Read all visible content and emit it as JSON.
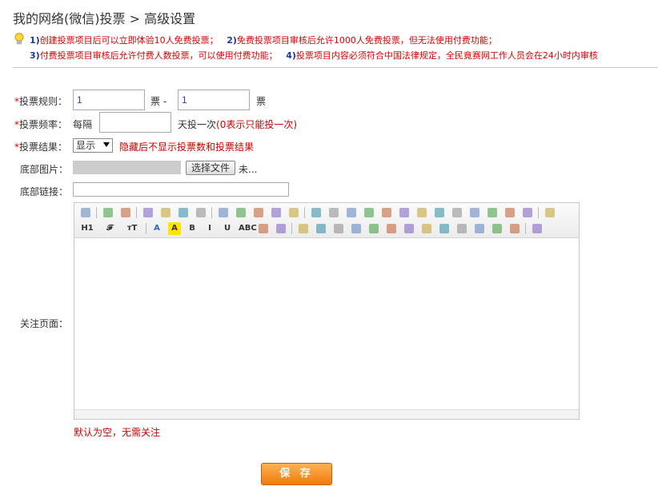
{
  "page": {
    "title": "我的网络(微信)投票 > 高级设置"
  },
  "tips": {
    "n1": "1)",
    "t1": "创建投票项目后可以立即体验10人免费投票；",
    "n2": "2)",
    "t2": "免费投票项目审核后允许1000人免费投票，但无法使用付费功能；",
    "n3": "3)",
    "t3": "付费投票项目审核后允许付费人数投票，可以使用付费功能；",
    "n4": "4)",
    "t4": "投票项目内容必须符合中国法律规定，全民竟赛网工作人员会在24小时内审核"
  },
  "form": {
    "rule": {
      "label": "投票规则：",
      "min": "1",
      "unit1": "票 -",
      "max": "1",
      "unit2": "票"
    },
    "freq": {
      "label": "投票频率：",
      "prefix": "每隔",
      "value": "",
      "suffix": "天投一次",
      "hint": "(0表示只能投一次)"
    },
    "result": {
      "label": "投票结果：",
      "selected": "显示",
      "hint": "隐藏后不显示投票数和投票结果"
    },
    "image": {
      "label": "底部图片：",
      "button": "选择文件",
      "status": "未..."
    },
    "link": {
      "label": "底部链接：",
      "value": ""
    },
    "follow": {
      "label": "关注页面：",
      "hint": "默认为空，无需关注"
    },
    "required_mark": "*"
  },
  "toolbar": {
    "row1": [
      "source-icon",
      "undo-icon",
      "redo-icon",
      "preview-icon",
      "print-icon",
      "template-icon",
      "code-icon",
      "cut-icon",
      "copy-icon",
      "paste-icon",
      "paste-text-icon",
      "paste-word-icon",
      "align-left-icon",
      "align-center-icon",
      "align-right-icon",
      "align-justify-icon",
      "ordered-list-icon",
      "unordered-list-icon",
      "indent-icon",
      "outdent-icon",
      "subscript-icon",
      "superscript-icon",
      "clear-format-icon",
      "format-painter-icon",
      "select-all-icon",
      "fullscreen-icon"
    ],
    "row2": [
      "heading-icon",
      "font-family-icon",
      "font-size-icon",
      "font-color-icon",
      "highlight-icon",
      "bold-icon",
      "italic-icon",
      "underline-icon",
      "strikethrough-icon",
      "line-height-icon",
      "remove-format-icon",
      "image-icon",
      "multi-image-icon",
      "flash-icon",
      "media-icon",
      "file-icon",
      "table-icon",
      "hr-icon",
      "emoticon-icon",
      "map-icon",
      "pagebreak-icon",
      "anchor-icon",
      "link-icon",
      "unlink-icon",
      "help-icon"
    ],
    "row2_labels": {
      "heading": "H1",
      "font": "𝓕",
      "size": "тT",
      "fontcolor": "A",
      "highlight": "A",
      "bold": "B",
      "italic": "I",
      "underline": "U",
      "strike": "ABC"
    }
  },
  "actions": {
    "save": "保 存"
  },
  "colors": {
    "accent": "#f07a0e",
    "error": "#cc0000",
    "tip_number": "#1a3a9a"
  }
}
